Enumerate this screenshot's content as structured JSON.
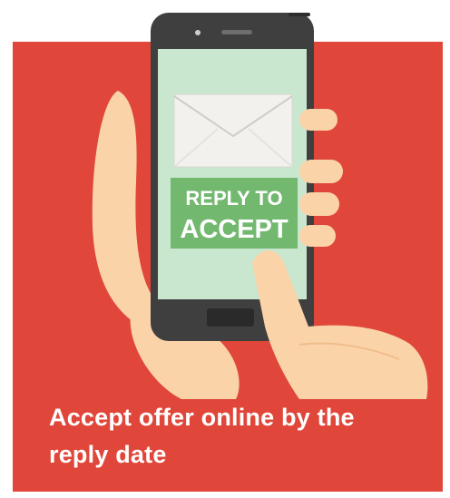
{
  "phone_screen": {
    "button_line1": "REPLY TO",
    "button_line2": "ACCEPT"
  },
  "caption": {
    "line1": "Accept offer online by the",
    "line2": "reply date"
  },
  "colors": {
    "background_panel": "#e0473a",
    "screen": "#c9e6cf",
    "button": "#72b86f",
    "phone_body": "#3f3f3f",
    "skin": "#fbd3a9"
  },
  "icons": [
    "envelope-icon",
    "hand-holding-phone",
    "finger-tapping"
  ]
}
